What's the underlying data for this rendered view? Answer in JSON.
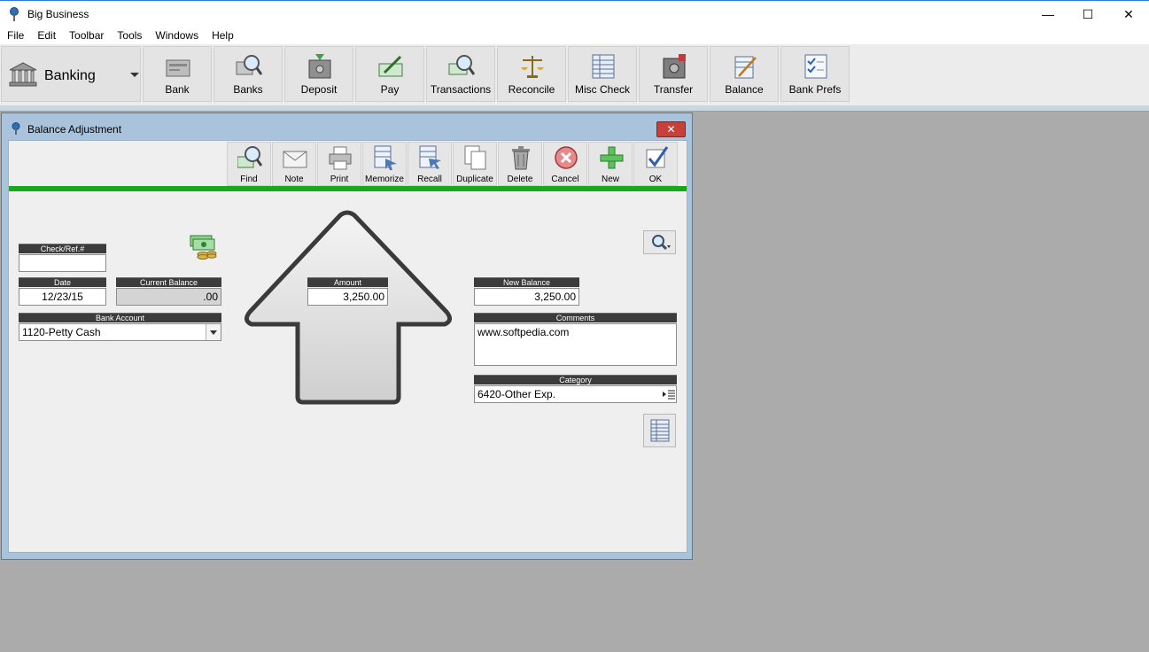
{
  "window": {
    "title": "Big Business",
    "minimize_glyph": "—",
    "maximize_glyph": "☐",
    "close_glyph": "✕"
  },
  "menu": [
    "File",
    "Edit",
    "Toolbar",
    "Tools",
    "Windows",
    "Help"
  ],
  "toolbar": {
    "module_label": "Banking",
    "buttons": [
      "Bank",
      "Banks",
      "Deposit",
      "Pay",
      "Transactions",
      "Reconcile",
      "Misc Check",
      "Transfer",
      "Balance",
      "Bank Prefs"
    ]
  },
  "dialog": {
    "title": "Balance Adjustment",
    "close_glyph": "✕",
    "actions": [
      "Find",
      "Note",
      "Print",
      "Memorize",
      "Recall",
      "Duplicate",
      "Delete",
      "Cancel",
      "New",
      "OK"
    ],
    "fields": {
      "check_ref": {
        "label": "Check/Ref.#",
        "value": ""
      },
      "date": {
        "label": "Date",
        "value": "12/23/15"
      },
      "current_balance": {
        "label": "Current Balance",
        "value": ".00"
      },
      "bank_account": {
        "label": "Bank Account",
        "value": "1120-Petty Cash"
      },
      "amount": {
        "label": "Amount",
        "value": "3,250.00"
      },
      "new_balance": {
        "label": "New Balance",
        "value": "3,250.00"
      },
      "comments": {
        "label": "Comments",
        "value": "www.softpedia.com"
      },
      "category": {
        "label": "Category",
        "value": "6420-Other Exp."
      }
    }
  },
  "colors": {
    "accent_green": "#18a81d",
    "field_label_bg": "#3c3c3c",
    "workspace_bg": "#ababab"
  }
}
